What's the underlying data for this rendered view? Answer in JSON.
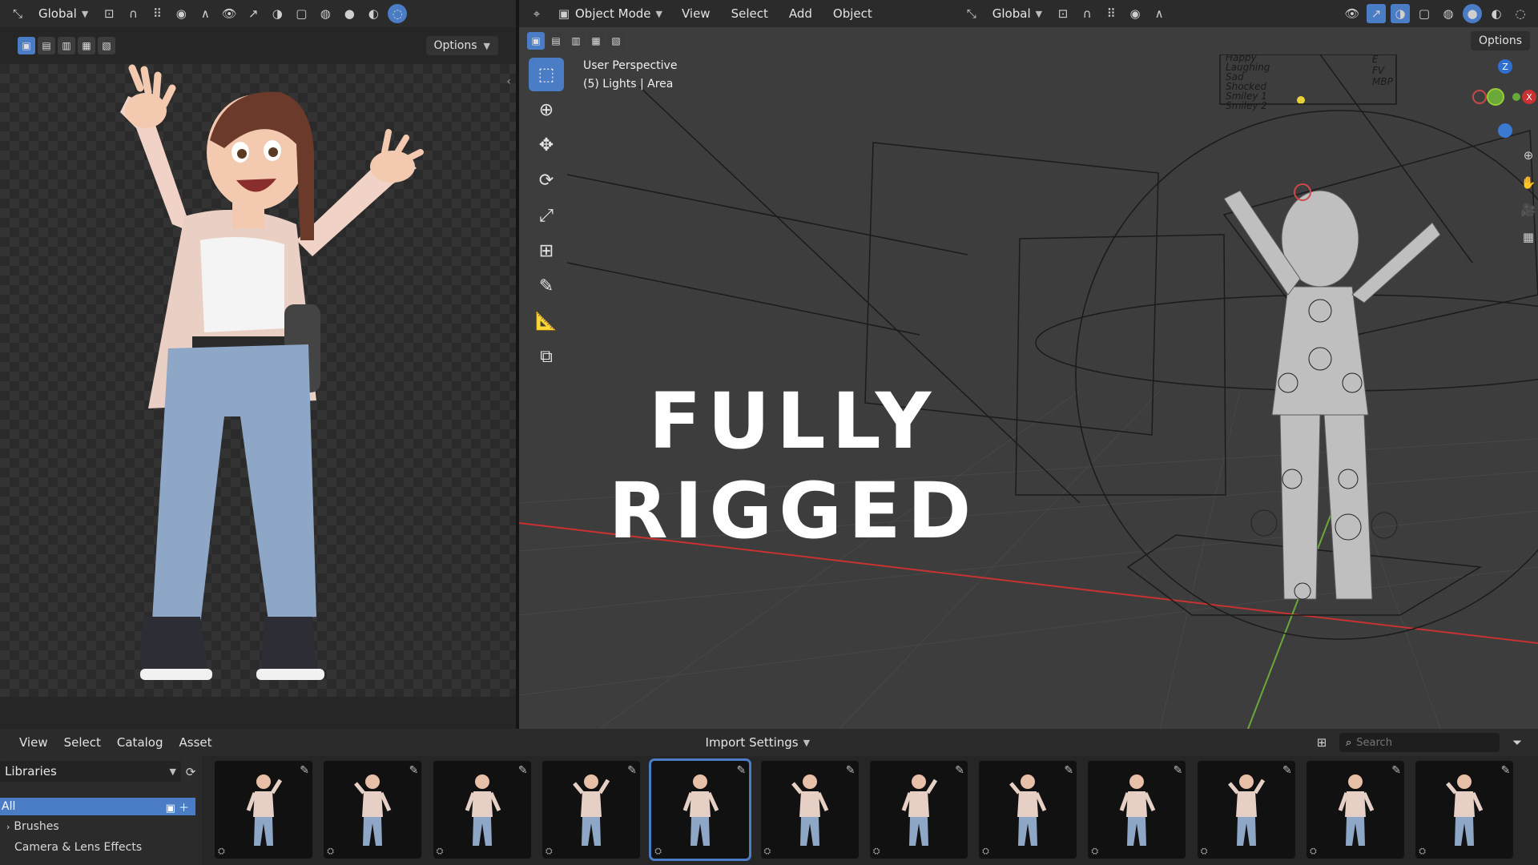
{
  "left_header": {
    "transform_orientation": "Global",
    "options_label": "Options"
  },
  "viewport_header": {
    "mode": "Object Mode",
    "menus": [
      "View",
      "Select",
      "Add",
      "Object"
    ],
    "transform_orientation": "Global",
    "options_label": "Options"
  },
  "viewport_info": {
    "line1": "User Perspective",
    "line2": "(5) Lights | Area"
  },
  "overlay_title": "FULLY RIGGED",
  "pose_board_labels": [
    "Happy",
    "Laughing",
    "Sad",
    "Shocked",
    "Smiley 1",
    "Smiley 2"
  ],
  "pose_board_labels_right": [
    "E",
    "FV",
    "MBP"
  ],
  "gizmo": {
    "z": "Z",
    "x": "X"
  },
  "asset_browser": {
    "menus": [
      "View",
      "Select",
      "Catalog",
      "Asset"
    ],
    "import_label": "Import Settings",
    "search_placeholder": "Search",
    "library": "Libraries",
    "catalogs": [
      "All",
      "Brushes",
      "Camera & Lens Effects"
    ],
    "thumb_count": 12,
    "selected_thumb": 4
  },
  "colors": {
    "accent": "#4b7cc6",
    "panel": "#2b2b2b",
    "viewport": "#3d3d3d",
    "x_axis": "#c83232",
    "y_axis": "#6aa83a"
  }
}
